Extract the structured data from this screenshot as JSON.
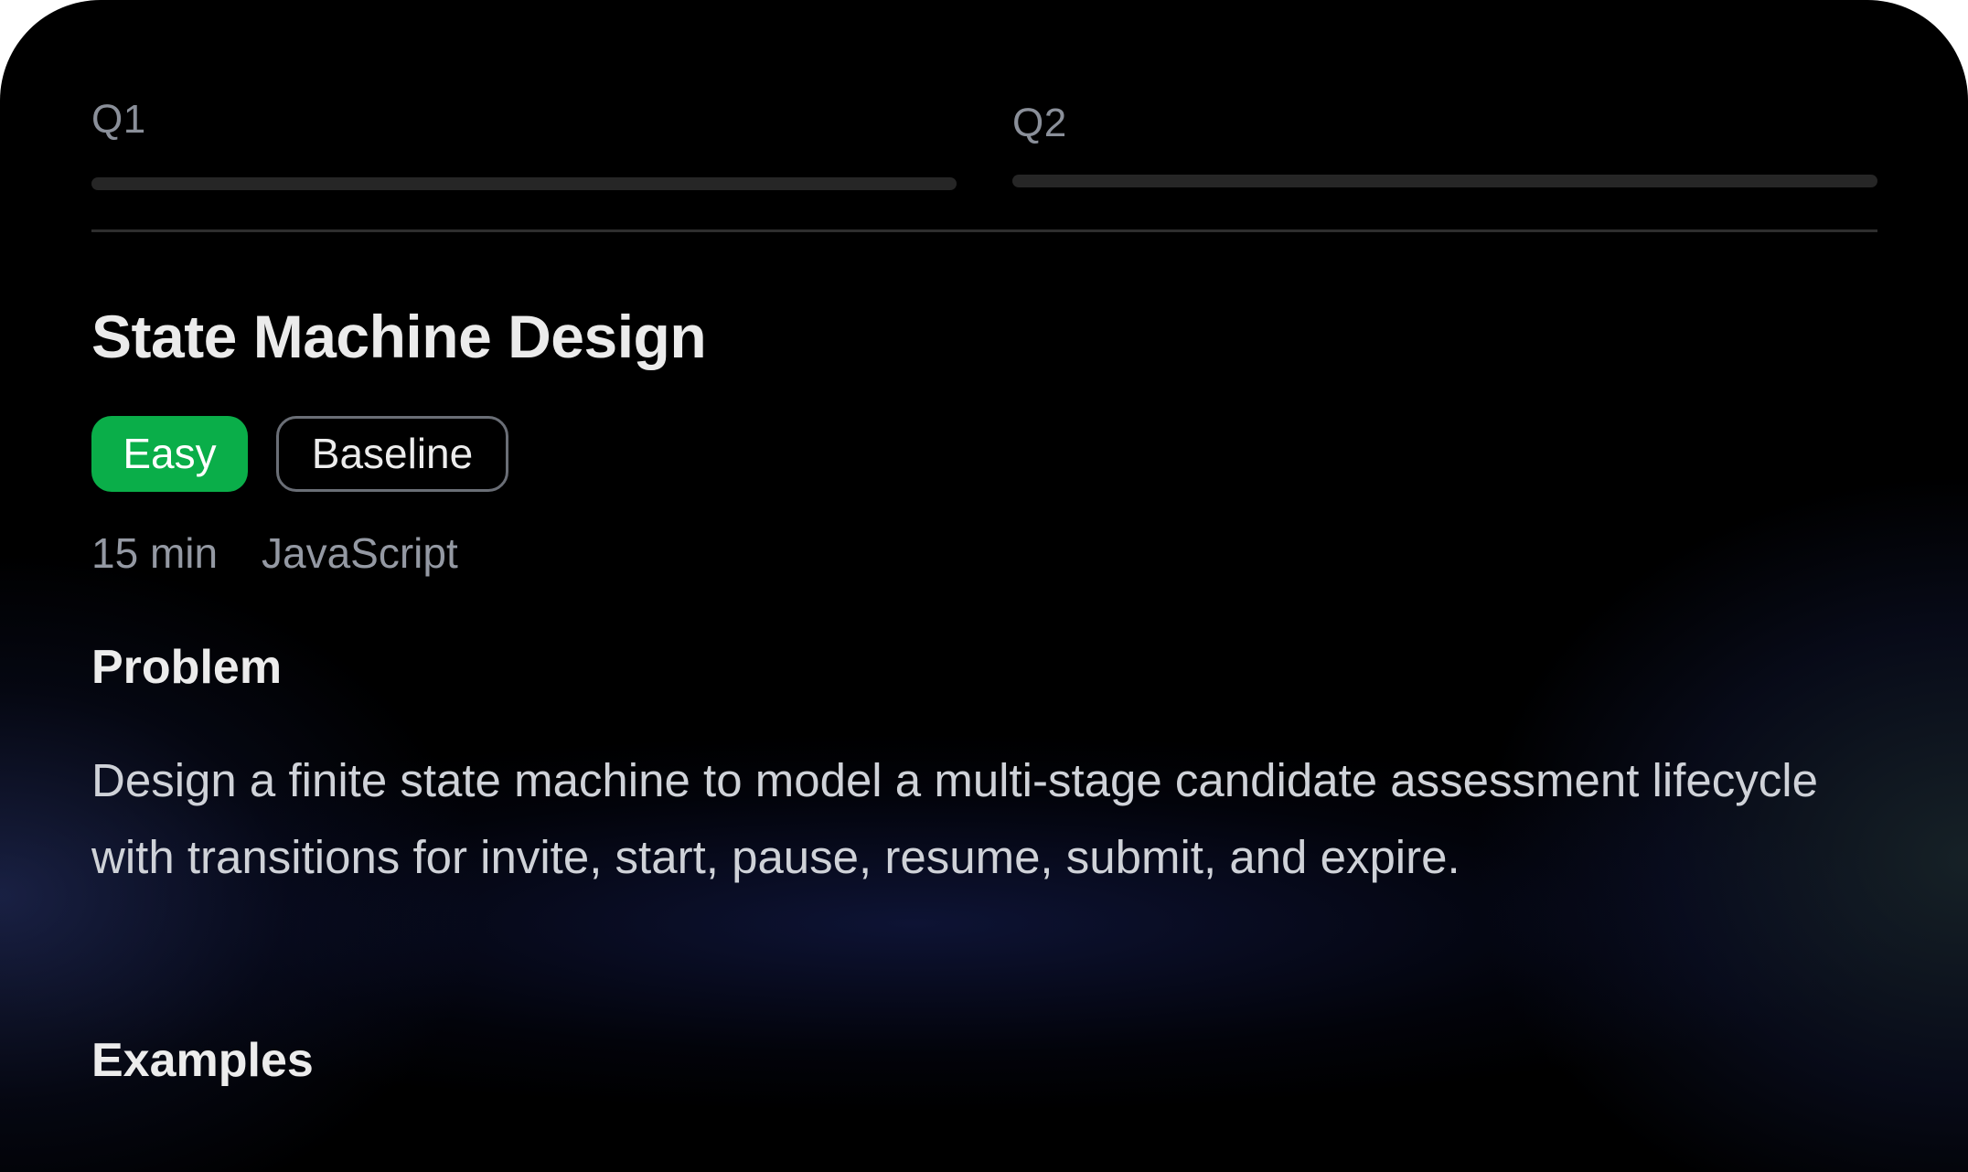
{
  "tabs": [
    {
      "label": "Q1"
    },
    {
      "label": "Q2"
    }
  ],
  "question": {
    "title": "State Machine Design",
    "difficulty": "Easy",
    "tag": "Baseline",
    "duration": "15 min",
    "language": "JavaScript"
  },
  "sections": {
    "problem_heading": "Problem",
    "problem_text": "Design a finite state machine to model a multi-stage candidate assessment lifecycle with transitions for invite, start, pause, resume, submit, and expire.",
    "examples_heading": "Examples"
  },
  "colors": {
    "background": "#000000",
    "easy_badge": "#0aae49",
    "accent_glow": "#2d3a78"
  }
}
